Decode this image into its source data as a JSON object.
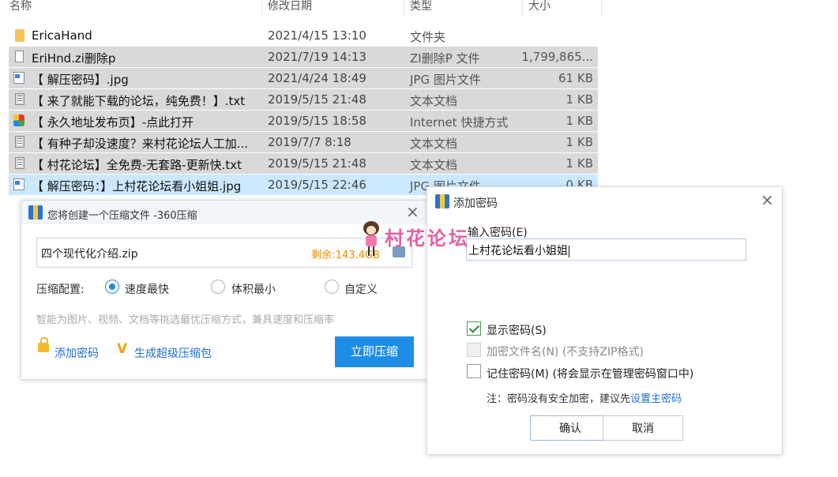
{
  "explorer": {
    "columns": {
      "name": "名称",
      "date": "修改日期",
      "type": "类型",
      "size": "大小"
    },
    "files": [
      {
        "name": "EricaHand",
        "date": "2021/4/15 13:10",
        "type": "文件夹",
        "size": "",
        "icon": "folder-icon",
        "state": "normal"
      },
      {
        "name": "EriHnd.zi删除p",
        "date": "2021/7/19 14:13",
        "type": "ZI删除P 文件",
        "size": "1,799,865...",
        "icon": "file-icon",
        "state": "selected"
      },
      {
        "name": "【 解压密码】.jpg",
        "date": "2021/4/24 18:49",
        "type": "JPG 图片文件",
        "size": "61 KB",
        "icon": "image-file-icon",
        "state": "selected"
      },
      {
        "name": "【 来了就能下载的论坛，纯免费！】.txt",
        "date": "2019/5/15 21:48",
        "type": "文本文档",
        "size": "1 KB",
        "icon": "text-file-icon",
        "state": "selected"
      },
      {
        "name": "【 永久地址发布页】-点此打开",
        "date": "2019/5/15 18:58",
        "type": "Internet 快捷方式",
        "size": "1 KB",
        "icon": "internet-shortcut-icon",
        "state": "selected"
      },
      {
        "name": "【 有种子却没速度？来村花论坛人工加...",
        "date": "2019/7/7 8:18",
        "type": "文本文档",
        "size": "1 KB",
        "icon": "text-file-icon",
        "state": "selected"
      },
      {
        "name": "【 村花论坛】全免费-无套路-更新快.txt",
        "date": "2019/5/15 21:48",
        "type": "文本文档",
        "size": "1 KB",
        "icon": "text-file-icon",
        "state": "selected"
      },
      {
        "name": "【 解压密码：】上村花论坛看小姐姐.jpg",
        "date": "2019/5/15 22:46",
        "type": "JPG 图片文件",
        "size": "0 KB",
        "icon": "image-file-icon",
        "state": "active"
      }
    ]
  },
  "compress_dialog": {
    "title": "您将创建一个压缩文件 -360压缩",
    "file_name": "四个现代化介绍.zip",
    "remaining": "剩余:143.4GB",
    "config_label": "压缩配置:",
    "options": [
      {
        "label": "速度最快",
        "selected": true
      },
      {
        "label": "体积最小",
        "selected": false
      },
      {
        "label": "自定义",
        "selected": false
      }
    ],
    "hint": "智能为图片、视频、文档等挑选最优压缩方式，兼具速度和压缩率",
    "add_password": "添加密码",
    "super_pack": "生成超级压缩包",
    "compress_now": "立即压缩"
  },
  "password_dialog": {
    "title": "添加密码",
    "input_label": "输入密码(E)",
    "password_value": "上村花论坛看小姐姐",
    "show_password": {
      "label": "显示密码(S)",
      "checked": true
    },
    "encrypt_names": {
      "label": "加密文件名(N) (不支持ZIP格式)",
      "checked": false,
      "disabled": true
    },
    "remember": {
      "label": "记住密码(M) (将会显示在管理密码窗口中)",
      "checked": false
    },
    "note": "注：密码没有安全加密，建议先",
    "note_link": "设置主密码",
    "ok": "确认",
    "cancel": "取消"
  },
  "watermark": {
    "text": "村花论坛"
  },
  "colors": {
    "accent": "#1e8de8",
    "selection": "#d9d9d9",
    "active_row": "#cce8ff",
    "link": "#1e6fd0",
    "remaining": "#f08a00"
  }
}
